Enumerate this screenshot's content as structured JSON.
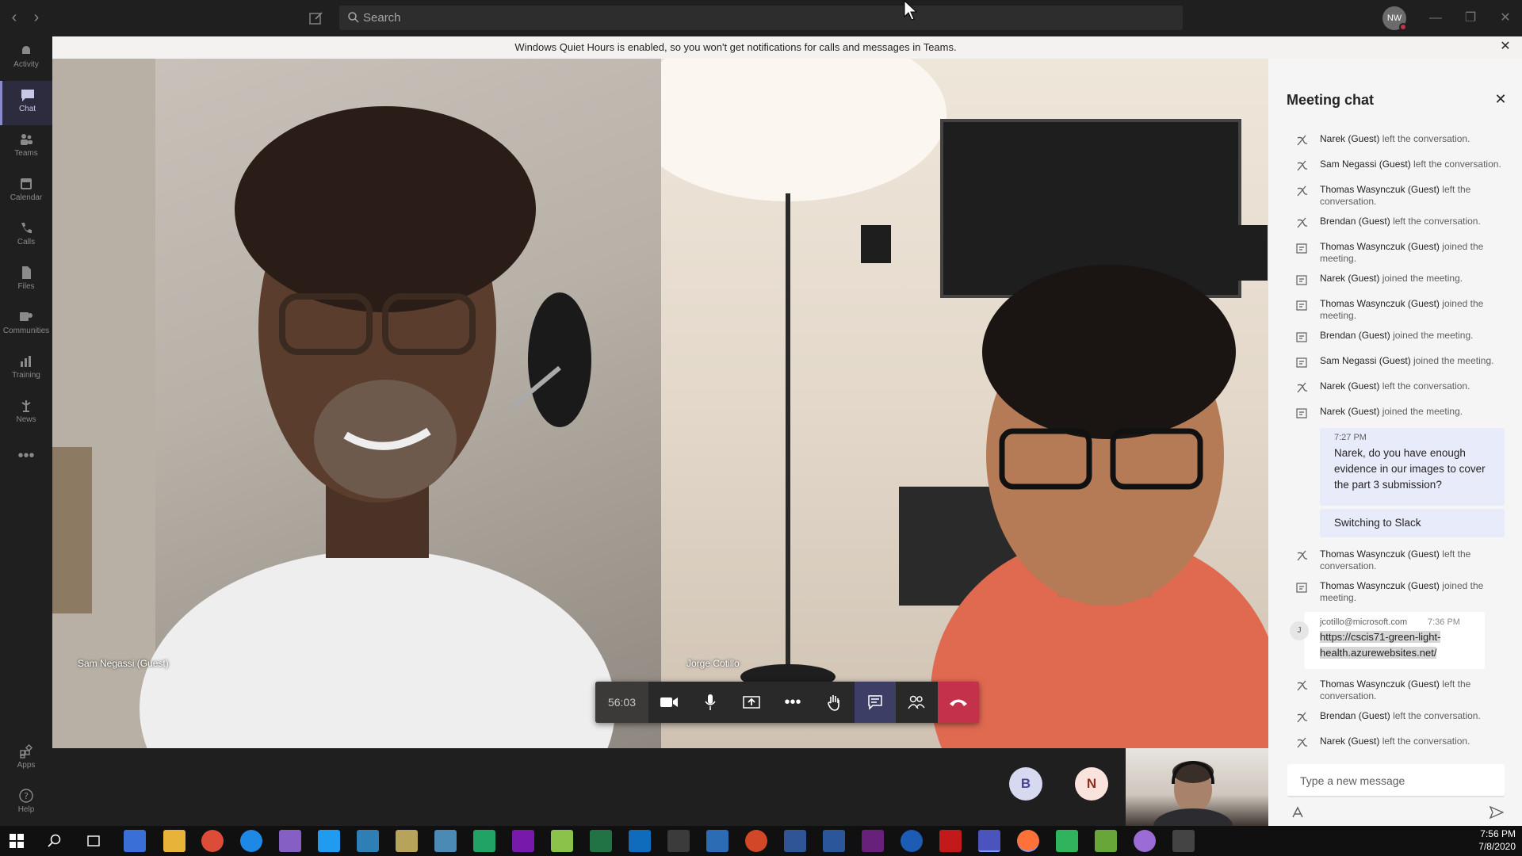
{
  "titlebar": {
    "search_placeholder": "Search",
    "avatar_initials": "NW"
  },
  "rail": {
    "items": [
      {
        "label": "Activity"
      },
      {
        "label": "Chat"
      },
      {
        "label": "Teams"
      },
      {
        "label": "Calendar"
      },
      {
        "label": "Calls"
      },
      {
        "label": "Files"
      },
      {
        "label": "Communities"
      },
      {
        "label": "Training"
      },
      {
        "label": "News"
      },
      {
        "label": "Apps"
      },
      {
        "label": "Help"
      }
    ]
  },
  "notification": {
    "text": "Windows Quiet Hours is enabled, so you won't get notifications for calls and messages in Teams."
  },
  "videos": {
    "left_name": "Sam Negassi (Guest)",
    "right_name": "Jorge Cotillo"
  },
  "controls": {
    "timer": "56:03"
  },
  "participants": [
    {
      "initial": "B"
    },
    {
      "initial": "N"
    }
  ],
  "chat": {
    "title": "Meeting chat",
    "events": [
      {
        "name": "Narek (Guest)",
        "action": "left the conversation."
      },
      {
        "name": "Sam Negassi (Guest)",
        "action": "left the conversation."
      },
      {
        "name": "Thomas Wasynczuk (Guest)",
        "action": "left the conversation."
      },
      {
        "name": "Brendan (Guest)",
        "action": "left the conversation."
      },
      {
        "name": "Thomas Wasynczuk (Guest)",
        "action": "joined the meeting."
      },
      {
        "name": "Narek (Guest)",
        "action": "joined the meeting."
      },
      {
        "name": "Thomas Wasynczuk (Guest)",
        "action": "joined the meeting."
      },
      {
        "name": "Brendan (Guest)",
        "action": "joined the meeting."
      },
      {
        "name": "Sam Negassi (Guest)",
        "action": "joined the meeting."
      },
      {
        "name": "Narek (Guest)",
        "action": "left the conversation."
      },
      {
        "name": "Narek (Guest)",
        "action": "joined the meeting."
      }
    ],
    "my_message": {
      "time": "7:27 PM",
      "text": "Narek, do you have enough evidence in our images to cover the part 3 submission?",
      "text2": "Switching to Slack"
    },
    "events2": [
      {
        "name": "Thomas Wasynczuk (Guest)",
        "action": "left the conversation."
      },
      {
        "name": "Thomas Wasynczuk (Guest)",
        "action": "joined the meeting."
      }
    ],
    "other_message": {
      "avatar": "J",
      "from": "jcotillo@microsoft.com",
      "time": "7:36 PM",
      "link": "https://cscis71-green-light-health.azurewebsites.net/"
    },
    "events3": [
      {
        "name": "Thomas Wasynczuk (Guest)",
        "action": "left the conversation."
      },
      {
        "name": "Brendan (Guest)",
        "action": "left the conversation."
      },
      {
        "name": "Narek (Guest)",
        "action": "left the conversation."
      }
    ],
    "compose_placeholder": "Type a new message"
  },
  "taskbar": {
    "time": "7:56 PM",
    "date": "7/8/2020"
  }
}
